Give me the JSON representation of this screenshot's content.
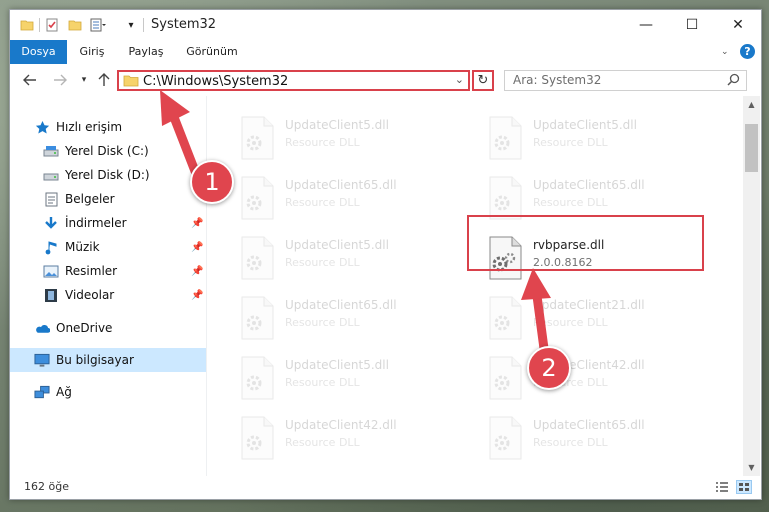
{
  "window": {
    "title": "System32",
    "minimize_glyph": "—",
    "maximize_glyph": "☐",
    "close_glyph": "✕"
  },
  "ribbon": {
    "tabs": [
      "Dosya",
      "Giriş",
      "Paylaş",
      "Görünüm"
    ],
    "help_glyph": "?"
  },
  "address": {
    "path": "C:\\Windows\\System32",
    "search_placeholder": "Ara: System32"
  },
  "sidebar": {
    "items": [
      {
        "label": "Hızlı erişim",
        "icon": "star-icon",
        "pinned": false
      },
      {
        "label": "Yerel Disk (C:)",
        "icon": "drive-icon",
        "pinned": false
      },
      {
        "label": "Yerel Disk (D:)",
        "icon": "drive-icon",
        "pinned": false
      },
      {
        "label": "Belgeler",
        "icon": "documents-icon",
        "pinned": false
      },
      {
        "label": "İndirmeler",
        "icon": "download-icon",
        "pinned": true
      },
      {
        "label": "Müzik",
        "icon": "music-icon",
        "pinned": true
      },
      {
        "label": "Resimler",
        "icon": "pictures-icon",
        "pinned": true
      },
      {
        "label": "Videolar",
        "icon": "video-icon",
        "pinned": true
      },
      {
        "label": "OneDrive",
        "icon": "cloud-icon",
        "pinned": false
      },
      {
        "label": "Bu bilgisayar",
        "icon": "computer-icon",
        "pinned": false,
        "selected": true
      },
      {
        "label": "Ağ",
        "icon": "network-icon",
        "pinned": false
      }
    ]
  },
  "files": [
    {
      "name": "UpdateClient5.dll",
      "desc": "Resource DLL",
      "faded": true
    },
    {
      "name": "UpdateClient5.dll",
      "desc": "Resource DLL",
      "faded": true
    },
    {
      "name": "UpdateClient65.dll",
      "desc": "Resource DLL",
      "faded": true
    },
    {
      "name": "UpdateClient65.dll",
      "desc": "Resource DLL",
      "faded": true
    },
    {
      "name": "UpdateClient5.dll",
      "desc": "Resource DLL",
      "faded": true
    },
    {
      "name": "rvbparse.dll",
      "desc": "2.0.0.8162",
      "faded": false
    },
    {
      "name": "UpdateClient65.dll",
      "desc": "Resource DLL",
      "faded": true
    },
    {
      "name": "UpdateClient21.dll",
      "desc": "Resource DLL",
      "faded": true
    },
    {
      "name": "UpdateClient5.dll",
      "desc": "Resource DLL",
      "faded": true
    },
    {
      "name": "UpdateClient42.dll",
      "desc": "Resource DLL",
      "faded": true
    },
    {
      "name": "UpdateClient42.dll",
      "desc": "Resource DLL",
      "faded": true
    },
    {
      "name": "UpdateClient65.dll",
      "desc": "Resource DLL",
      "faded": true
    }
  ],
  "status": {
    "item_count": "162 öğe"
  },
  "annotations": {
    "step1": "1",
    "step2": "2"
  },
  "colors": {
    "accent": "#1979ca",
    "highlight": "#d9414b",
    "selection": "#cce8ff"
  }
}
